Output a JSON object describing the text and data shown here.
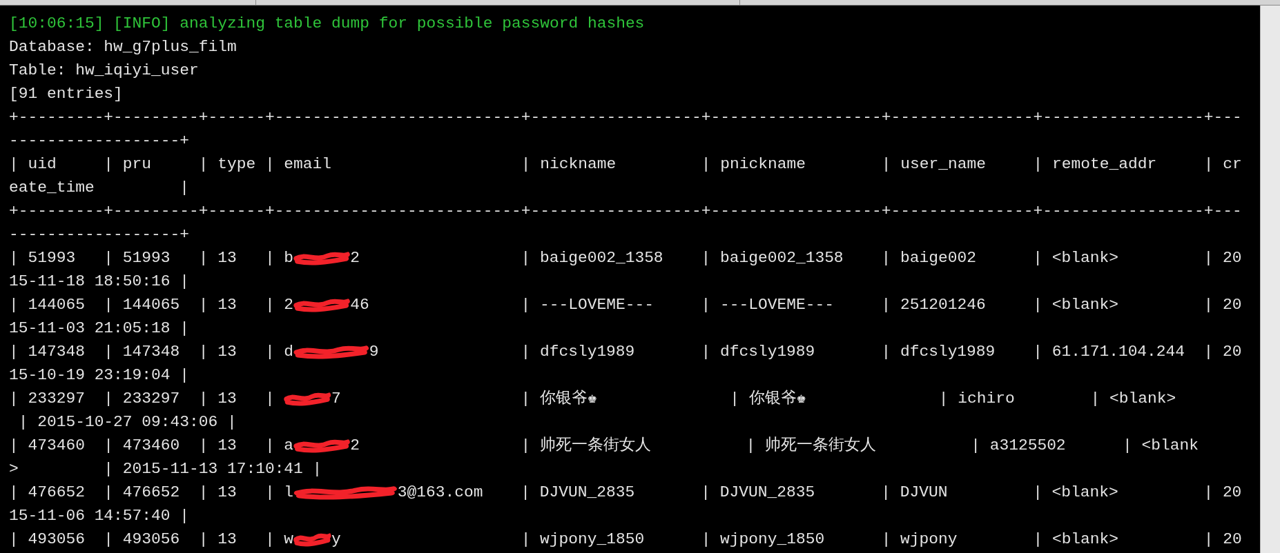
{
  "terminal": {
    "lines": [
      {
        "kind": "info",
        "segments": [
          {
            "kind": "text",
            "text": "[10:06:15] [INFO] analyzing table dump for possible password hashes"
          }
        ]
      },
      {
        "kind": "plain",
        "segments": [
          {
            "kind": "text",
            "text": "Database: hw_g7plus_film"
          }
        ]
      },
      {
        "kind": "plain",
        "segments": [
          {
            "kind": "text",
            "text": "Table: hw_iqiyi_user"
          }
        ]
      },
      {
        "kind": "plain",
        "segments": [
          {
            "kind": "text",
            "text": "[91 entries]"
          }
        ]
      },
      {
        "kind": "plain",
        "segments": [
          {
            "kind": "text",
            "text": "+---------+---------+------+--------------------------+------------------+------------------+---------------+-----------------+---"
          }
        ]
      },
      {
        "kind": "plain",
        "segments": [
          {
            "kind": "text",
            "text": "------------------+"
          }
        ]
      },
      {
        "kind": "plain",
        "segments": [
          {
            "kind": "text",
            "text": "| uid     | pru     | type | email                    | nickname         | pnickname        | user_name     | remote_addr     | cr"
          }
        ]
      },
      {
        "kind": "plain",
        "segments": [
          {
            "kind": "text",
            "text": "eate_time         |"
          }
        ]
      },
      {
        "kind": "plain",
        "segments": [
          {
            "kind": "text",
            "text": "+---------+---------+------+--------------------------+------------------+------------------+---------------+-----------------+---"
          }
        ]
      },
      {
        "kind": "plain",
        "segments": [
          {
            "kind": "text",
            "text": "------------------+"
          }
        ]
      },
      {
        "kind": "plain",
        "segments": [
          {
            "kind": "text",
            "text": "| 51993   | 51993   | 13   | b"
          },
          {
            "kind": "redaction_m"
          },
          {
            "kind": "text",
            "text": "2                 | baige002_1358    | baige002_1358    | baige002      | <blank>         | 20"
          }
        ]
      },
      {
        "kind": "plain",
        "segments": [
          {
            "kind": "text",
            "text": "15-11-18 18:50:16 |"
          }
        ]
      },
      {
        "kind": "plain",
        "segments": [
          {
            "kind": "text",
            "text": "| 144065  | 144065  | 13   | 2"
          },
          {
            "kind": "redaction_m"
          },
          {
            "kind": "text",
            "text": "46                | ---LOVEME---     | ---LOVEME---     | 251201246     | <blank>         | 20"
          }
        ]
      },
      {
        "kind": "plain",
        "segments": [
          {
            "kind": "text",
            "text": "15-11-03 21:05:18 |"
          }
        ]
      },
      {
        "kind": "plain",
        "segments": [
          {
            "kind": "text",
            "text": "| 147348  | 147348  | 13   | d"
          },
          {
            "kind": "redaction_l"
          },
          {
            "kind": "text",
            "text": "9               | dfcsly1989       | dfcsly1989       | dfcsly1989    | 61.171.104.244  | 20"
          }
        ]
      },
      {
        "kind": "plain",
        "segments": [
          {
            "kind": "text",
            "text": "15-10-19 23:19:04 |"
          }
        ]
      },
      {
        "kind": "plain",
        "segments": [
          {
            "kind": "text",
            "text": "| 233297  | 233297  | 13   | "
          },
          {
            "kind": "redaction_s"
          },
          {
            "kind": "text",
            "text": "7                   | 你银爷♚              | 你银爷♚              | ichiro        | <blank>"
          }
        ]
      },
      {
        "kind": "plain",
        "segments": [
          {
            "kind": "text",
            "text": " | 2015-10-27 09:43:06 |"
          }
        ]
      },
      {
        "kind": "plain",
        "segments": [
          {
            "kind": "text",
            "text": "| 473460  | 473460  | 13   | a"
          },
          {
            "kind": "redaction_m"
          },
          {
            "kind": "text",
            "text": "2                 | 帅死一条街女人          | 帅死一条街女人          | a3125502      | <blank"
          }
        ]
      },
      {
        "kind": "plain",
        "segments": [
          {
            "kind": "text",
            "text": ">         | 2015-11-13 17:10:41 |"
          }
        ]
      },
      {
        "kind": "plain",
        "segments": [
          {
            "kind": "text",
            "text": "| 476652  | 476652  | 13   | l"
          },
          {
            "kind": "redaction_xl"
          },
          {
            "kind": "text",
            "text": "3@163.com    | DJVUN_2835       | DJVUN_2835       | DJVUN         | <blank>         | 20"
          }
        ]
      },
      {
        "kind": "plain",
        "segments": [
          {
            "kind": "text",
            "text": "15-11-06 14:57:40 |"
          }
        ]
      },
      {
        "kind": "plain",
        "segments": [
          {
            "kind": "text",
            "text": "| 493056  | 493056  | 13   | w"
          },
          {
            "kind": "redaction_xs"
          },
          {
            "kind": "text",
            "text": "y                   | wjpony_1850      | wjpony_1850      | wjpony        | <blank>         | 20"
          }
        ]
      }
    ]
  }
}
